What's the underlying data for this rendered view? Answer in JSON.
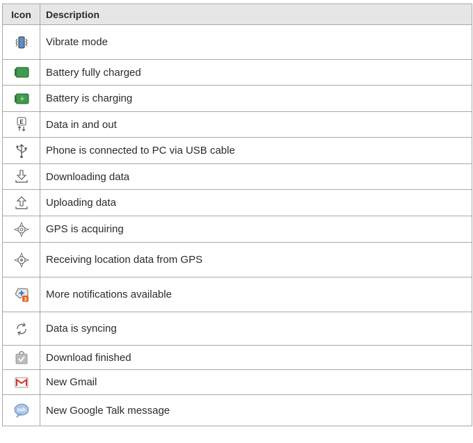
{
  "table": {
    "headers": {
      "icon": "Icon",
      "description": "Description"
    },
    "rows": [
      {
        "icon": "vibrate-icon",
        "description": "Vibrate mode"
      },
      {
        "icon": "battery-full-icon",
        "description": "Battery fully charged"
      },
      {
        "icon": "battery-charging-icon",
        "description": "Battery is charging"
      },
      {
        "icon": "data-in-out-icon",
        "description": "Data in and out"
      },
      {
        "icon": "usb-icon",
        "description": "Phone is connected to PC via USB cable"
      },
      {
        "icon": "download-icon",
        "description": "Downloading data"
      },
      {
        "icon": "upload-icon",
        "description": "Uploading data"
      },
      {
        "icon": "gps-acquiring-icon",
        "description": "GPS is acquiring"
      },
      {
        "icon": "gps-receiving-icon",
        "description": "Receiving location data from GPS"
      },
      {
        "icon": "more-notifications-icon",
        "description": "More notifications available",
        "badge": "3"
      },
      {
        "icon": "sync-icon",
        "description": "Data is syncing"
      },
      {
        "icon": "download-finished-icon",
        "description": "Download finished"
      },
      {
        "icon": "gmail-icon",
        "description": "New Gmail"
      },
      {
        "icon": "google-talk-icon",
        "description": "New Google Talk message",
        "glyph": "talk"
      }
    ]
  }
}
